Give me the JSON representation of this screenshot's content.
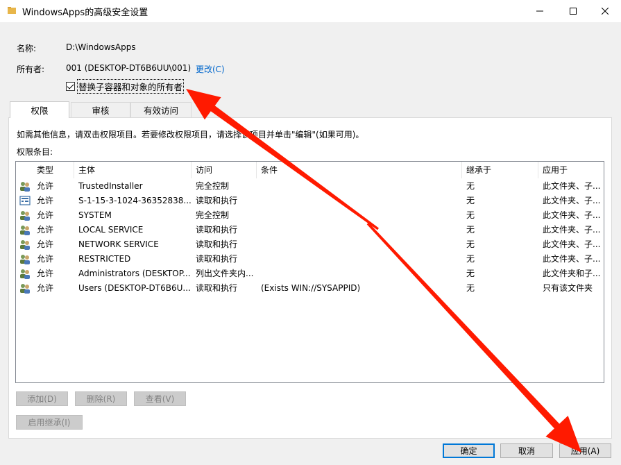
{
  "window": {
    "title": "WindowsApps的高级安全设置"
  },
  "info": {
    "name_label": "名称:",
    "name_value": "D:\\WindowsApps",
    "owner_label": "所有者:",
    "owner_value": "001 (DESKTOP-DT6B6UU\\001)",
    "change_link": "更改(C)",
    "replace_owner_checkbox": "替换子容器和对象的所有者",
    "replace_owner_checked": true
  },
  "tabs": [
    {
      "label": "权限",
      "active": true
    },
    {
      "label": "审核",
      "active": false
    },
    {
      "label": "有效访问",
      "active": false
    }
  ],
  "panel": {
    "hint": "如需其他信息，请双击权限项目。若要修改权限项目，请选择该项目并单击\"编辑\"(如果可用)。",
    "entries_label": "权限条目:"
  },
  "table": {
    "headers": [
      "类型",
      "主体",
      "访问",
      "条件",
      "继承于",
      "应用于"
    ],
    "rows": [
      {
        "icon": "users-icon",
        "type": "允许",
        "principal": "TrustedInstaller",
        "access": "完全控制",
        "condition": "",
        "inherited": "无",
        "applies": "此文件夹、子..."
      },
      {
        "icon": "sid-icon",
        "type": "允许",
        "principal": "S-1-15-3-1024-36352838...",
        "access": "读取和执行",
        "condition": "",
        "inherited": "无",
        "applies": "此文件夹、子..."
      },
      {
        "icon": "users-icon",
        "type": "允许",
        "principal": "SYSTEM",
        "access": "完全控制",
        "condition": "",
        "inherited": "无",
        "applies": "此文件夹、子..."
      },
      {
        "icon": "users-icon",
        "type": "允许",
        "principal": "LOCAL SERVICE",
        "access": "读取和执行",
        "condition": "",
        "inherited": "无",
        "applies": "此文件夹、子..."
      },
      {
        "icon": "users-icon",
        "type": "允许",
        "principal": "NETWORK SERVICE",
        "access": "读取和执行",
        "condition": "",
        "inherited": "无",
        "applies": "此文件夹、子..."
      },
      {
        "icon": "users-icon",
        "type": "允许",
        "principal": "RESTRICTED",
        "access": "读取和执行",
        "condition": "",
        "inherited": "无",
        "applies": "此文件夹、子..."
      },
      {
        "icon": "users-icon",
        "type": "允许",
        "principal": "Administrators (DESKTOP...",
        "access": "列出文件夹内...",
        "condition": "",
        "inherited": "无",
        "applies": "此文件夹和子..."
      },
      {
        "icon": "users-icon",
        "type": "允许",
        "principal": "Users (DESKTOP-DT6B6U...",
        "access": "读取和执行",
        "condition": "(Exists WIN://SYSAPPID)",
        "inherited": "无",
        "applies": "只有该文件夹"
      }
    ]
  },
  "actions": {
    "add": "添加(D)",
    "remove": "删除(R)",
    "view": "查看(V)",
    "enable_inheritance": "启用继承(I)"
  },
  "footer": {
    "ok": "确定",
    "cancel": "取消",
    "apply": "应用(A)"
  },
  "annotation_color": "#ff1a00"
}
